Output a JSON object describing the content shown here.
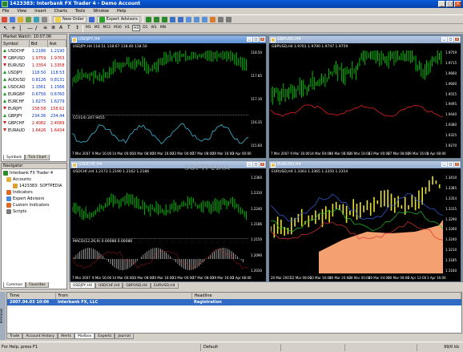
{
  "window": {
    "title": "1423383: Interbank FX Trader 4 - Demo Account"
  },
  "menu": [
    "File",
    "View",
    "Insert",
    "Charts",
    "Tools",
    "Window",
    "Help"
  ],
  "toolbar": {
    "new_order": "New Order",
    "expert_advisors": "Expert Advisors"
  },
  "timeframes": [
    "M1",
    "M5",
    "M15",
    "M30",
    "H1",
    "H4",
    "D1",
    "W1",
    "MN"
  ],
  "active_timeframe": "H4",
  "market_watch": {
    "title": "Market Watch: 10:07:06",
    "headers": [
      "Symbol",
      "Bid",
      "Ask"
    ],
    "rows": [
      {
        "symbol": "USDCHF",
        "bid": "1.2186",
        "ask": "1.2190",
        "dir": "up"
      },
      {
        "symbol": "GBPUSD",
        "bid": "1.9759",
        "ask": "1.9763",
        "dir": "down"
      },
      {
        "symbol": "EURUSD",
        "bid": "1.3354",
        "ask": "1.3358",
        "dir": "down"
      },
      {
        "symbol": "USDJPY",
        "bid": "118.50",
        "ask": "118.53",
        "dir": "up"
      },
      {
        "symbol": "AUDUSD",
        "bid": "0.8126",
        "ask": "0.8131",
        "dir": "up"
      },
      {
        "symbol": "USDCAD",
        "bid": "1.1561",
        "ask": "1.1566",
        "dir": "up"
      },
      {
        "symbol": "EURGBP",
        "bid": "0.6756",
        "ask": "0.6760",
        "dir": "up"
      },
      {
        "symbol": "EURCHF",
        "bid": "1.6275",
        "ask": "1.6279",
        "dir": "up"
      },
      {
        "symbol": "EURJPY",
        "bid": "158.58",
        "ask": "158.62",
        "dir": "down"
      },
      {
        "symbol": "GBPJPY",
        "bid": "234.36",
        "ask": "234.44",
        "dir": "up"
      },
      {
        "symbol": "GBPCHF",
        "bid": "2.4082",
        "ask": "2.4089",
        "dir": "down"
      },
      {
        "symbol": "EURAUD",
        "bid": "1.6426",
        "ask": "1.6434",
        "dir": "down"
      }
    ],
    "tabs": [
      "Symbols",
      "Tick Chart"
    ]
  },
  "navigator": {
    "title": "Navigator",
    "root": "Interbank FX Trader 4",
    "items": [
      "Accounts",
      "1423383: SOFTPEDIA",
      "Indicators",
      "Expert Advisors",
      "Custom Indicators",
      "Scripts"
    ],
    "tabs": [
      "Common",
      "Favorites"
    ]
  },
  "charts": {
    "usdjpy": {
      "window_title": "USDJPY,H4",
      "label": "USDJPY,H4  118.51 118.67 118.40 118.50",
      "osc_label": "CCI(14) 247.9455",
      "prices": [
        "118.50",
        "117.85",
        "117.10",
        "116.35",
        "115.60"
      ],
      "osc_scale": [
        "310",
        "100",
        "0",
        "-100",
        "-276.270"
      ],
      "dates": [
        "7 Mar 2007",
        "9 Mar 16:00",
        "14 Mar 00:00",
        "16 Mar 08:00",
        "20 Mar 16:00",
        "23 Mar 00:00",
        "27 Mar 08:00",
        "29 Mar 16:00",
        "3 Apr 00:00"
      ]
    },
    "gbpusd": {
      "window_title": "GBPUSD,H4",
      "label": "GBPUSD,H4  1.9761 1.9790 1.9747 1.9759",
      "prices": [
        "1.9759",
        "1.9715",
        "1.9660",
        "1.9600",
        "1.9555",
        "1.9495",
        "1.9440",
        "1.9380",
        "1.9325",
        "1.9270"
      ],
      "dates": [
        "7 Mar 2007",
        "9 Mar 16:00",
        "14 Mar 00:00",
        "16 Mar 08:00",
        "20 Mar 16:00",
        "23 Mar 00:00",
        "27 Mar 08:00",
        "29 Mar 16:00",
        "2 Apr 08:00"
      ]
    },
    "usdchf": {
      "window_title": "USDCHF,H4",
      "label": "USDCHF,H4  1.2173 1.2190 1.2162 1.2186",
      "osc_label": "MACD(12,26,9) 0.00088 0.00086",
      "prices": [
        "1.2360",
        "1.2310",
        "1.2240",
        "1.2186",
        "1.2150",
        "1.2090",
        "1.2030"
      ],
      "osc_scale": [
        "0.00590",
        "0.00000",
        "-0.00593"
      ],
      "dates": [
        "7 Mar 2007",
        "9 Mar 16:00",
        "14 Mar 00:00",
        "16 Mar 08:00",
        "20 Mar 16:00",
        "23 Mar 00:00",
        "27 Mar 08:00",
        "29 Mar 16:00",
        "2 Apr 08:00"
      ]
    },
    "eurusd": {
      "window_title": "EURUSD,H4",
      "label": "EURUSD,H4  1.3363 1.3365 1.3350 1.3354",
      "prices": [
        "1.3410",
        "1.3385",
        "1.3354",
        "1.3315",
        "1.3290",
        "1.3260",
        "1.3240",
        "1.3210",
        "1.3185",
        "1.3160"
      ],
      "dates": [
        "20 Mar 2007",
        "22 Mar 08:00",
        "23 Mar 16:00",
        "26 Mar 20:00",
        "28 Mar 00:00",
        "29 Mar 04:00",
        "30 Mar 08:00",
        "2 Apr 12:00",
        "3 Apr 16:00"
      ]
    }
  },
  "chart_tabs": [
    "USDJPY,H4",
    "USDCHF,H4",
    "GBPUSD,H4",
    "EURUSD,H4"
  ],
  "terminal": {
    "headers": [
      "Time",
      "From",
      "Headline"
    ],
    "rows": [
      {
        "time": "2007.04.03 10:06",
        "from": "Interbank FX, LLC",
        "headline": "Registration"
      }
    ],
    "tabs": [
      "Trade",
      "Account History",
      "Alerts",
      "Mailbox",
      "Experts",
      "Journal"
    ],
    "active_tab": "Mailbox",
    "side_label": "Terminal"
  },
  "watermark": "SOFTPEDIA",
  "status": {
    "help": "For Help, press F1",
    "profile": "Default",
    "traffic": "99/0 kb"
  }
}
